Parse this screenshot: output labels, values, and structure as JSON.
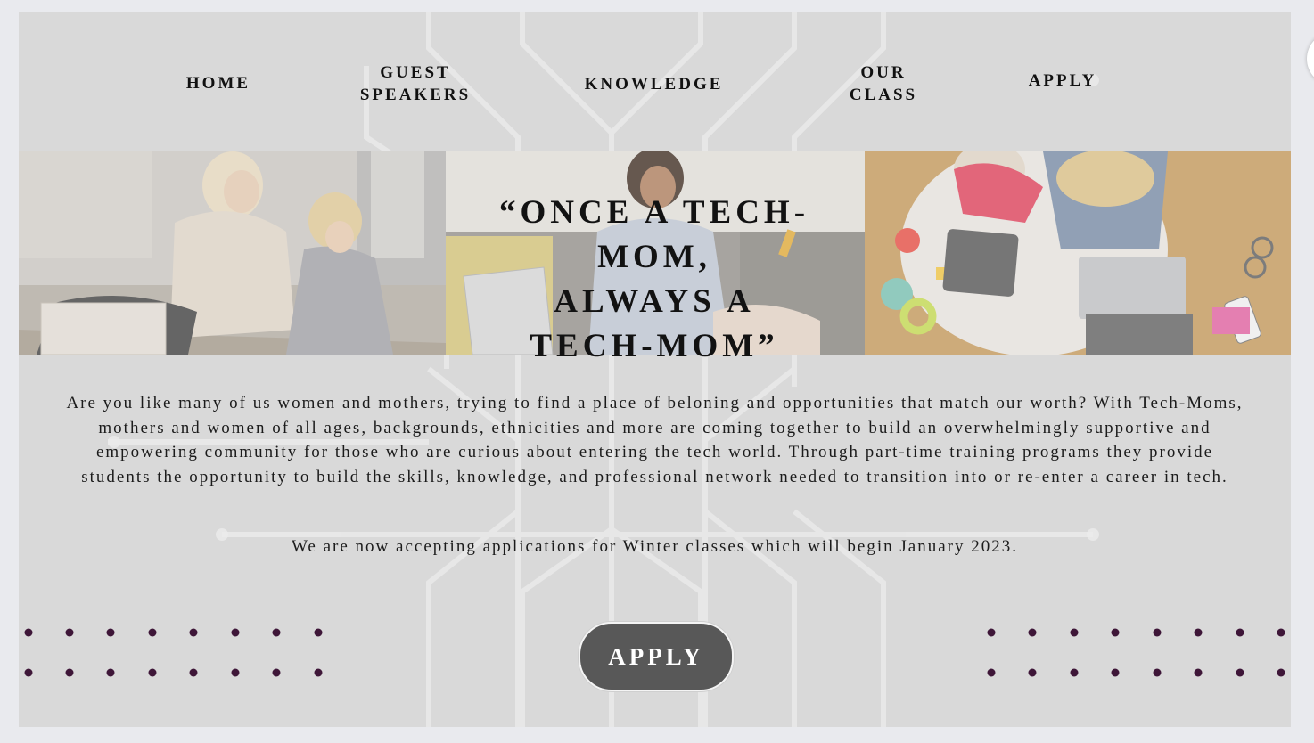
{
  "nav": {
    "home": "HOME",
    "guest_speakers": "GUEST\nSPEAKERS",
    "knowledge": "KNOWLEDGE",
    "our_class": "OUR\nCLASS",
    "apply": "APPLY"
  },
  "hero": {
    "quote": "“ONCE A TECH-MOM,\nALWAYS A\nTECH-MOM”"
  },
  "content": {
    "intro": "Are you like many of us women and mothers, trying to find a place of beloning and opportunities that match our worth? With Tech-Moms, mothers and women of all ages, backgrounds, ethnicities and more are coming together to build an overwhelmingly supportive and empowering community for those who are curious about entering the tech world. Through part-time training programs they provide students the opportunity to build the skills, knowledge, and professional network needed to transition into or re-enter a career in tech.",
    "winter": "We are now accepting applications for Winter classes which will begin January 2023."
  },
  "apply_button": {
    "label": "APPLY"
  },
  "colors": {
    "background": "#d9d9d9",
    "dot_accent": "#3e1638",
    "button_fill": "#585858"
  }
}
